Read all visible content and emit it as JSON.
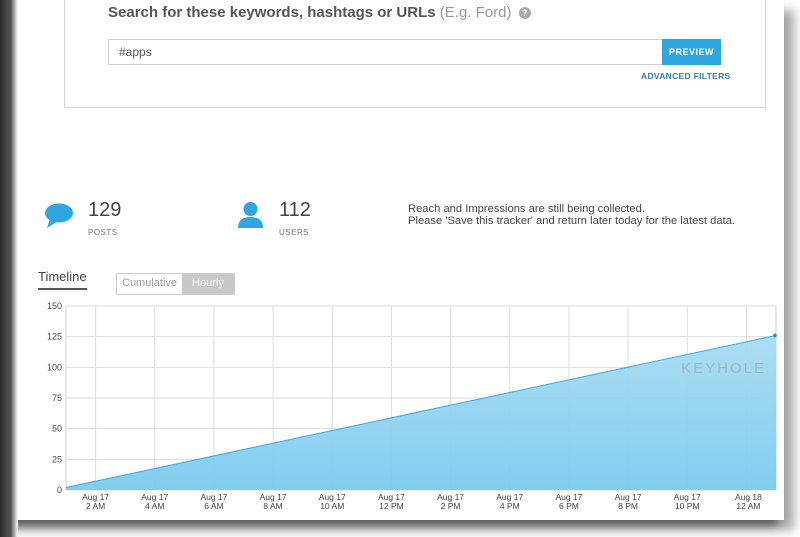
{
  "search": {
    "title": "Search for these keywords, hashtags or URLs",
    "example": "(E.g. Ford)",
    "help_icon": "question-circle-icon",
    "value": "#apps",
    "preview_label": "PREVIEW",
    "advanced_label": "ADVANCED FILTERS"
  },
  "stats": {
    "posts": {
      "value": "129",
      "label": "POSTS",
      "icon": "speech-bubble-icon"
    },
    "users": {
      "value": "112",
      "label": "USERS",
      "icon": "user-icon"
    }
  },
  "notice": {
    "line1": "Reach and Impressions are still being collected.",
    "line2": "Please 'Save this tracker' and return later today for the latest data."
  },
  "timeline": {
    "tab_label": "Timeline",
    "toggle": {
      "cumulative": "Cumulative",
      "hourly": "Hourly",
      "selected": "Hourly"
    }
  },
  "watermark": "KEYHOLE",
  "colors": {
    "accent": "#2ea6e0",
    "area_top": "#a8dcf3",
    "area_bottom": "#7ccaee",
    "line": "#3aa9e0"
  },
  "chart_data": {
    "type": "area",
    "y_ticks": [
      0,
      25,
      50,
      75,
      100,
      125,
      150
    ],
    "ylim": [
      0,
      150
    ],
    "x_labels": [
      [
        "Aug 17",
        "2 AM"
      ],
      [
        "Aug 17",
        "4 AM"
      ],
      [
        "Aug 17",
        "6 AM"
      ],
      [
        "Aug 17",
        "8 AM"
      ],
      [
        "Aug 17",
        "10 AM"
      ],
      [
        "Aug 17",
        "12 PM"
      ],
      [
        "Aug 17",
        "2 PM"
      ],
      [
        "Aug 17",
        "4 PM"
      ],
      [
        "Aug 17",
        "6 PM"
      ],
      [
        "Aug 17",
        "8 PM"
      ],
      [
        "Aug 17",
        "10 PM"
      ],
      [
        "Aug 18",
        "12 AM"
      ]
    ],
    "series": [
      {
        "x": [
          "Aug 17 1 AM",
          "Aug 18 1 AM"
        ],
        "y": [
          2,
          126
        ]
      }
    ],
    "grid": true
  }
}
